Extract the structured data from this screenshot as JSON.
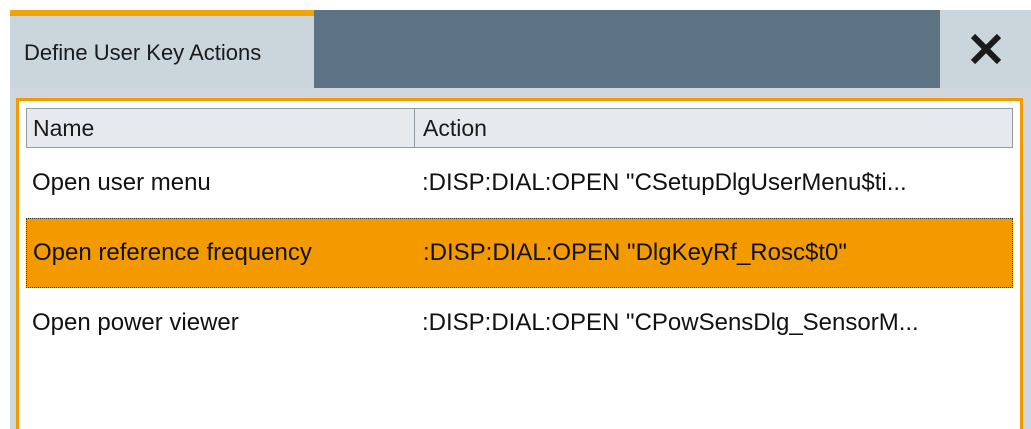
{
  "dialog": {
    "tab_title": "Define User Key Actions",
    "close_icon": "close-icon"
  },
  "table": {
    "columns": [
      "Name",
      "Action"
    ],
    "rows": [
      {
        "name": "Open user menu",
        "action": ":DISP:DIAL:OPEN \"CSetupDlgUserMenu$ti...",
        "selected": false
      },
      {
        "name": "Open reference frequency",
        "action": ":DISP:DIAL:OPEN \"DlgKeyRf_Rosc$t0\"",
        "selected": true
      },
      {
        "name": "Open power viewer",
        "action": ":DISP:DIAL:OPEN \"CPowSensDlg_SensorM...",
        "selected": false
      }
    ]
  },
  "colors": {
    "accent": "#f29a00",
    "titlebar": "#5d7282",
    "tab_background": "#cbd5dc"
  }
}
